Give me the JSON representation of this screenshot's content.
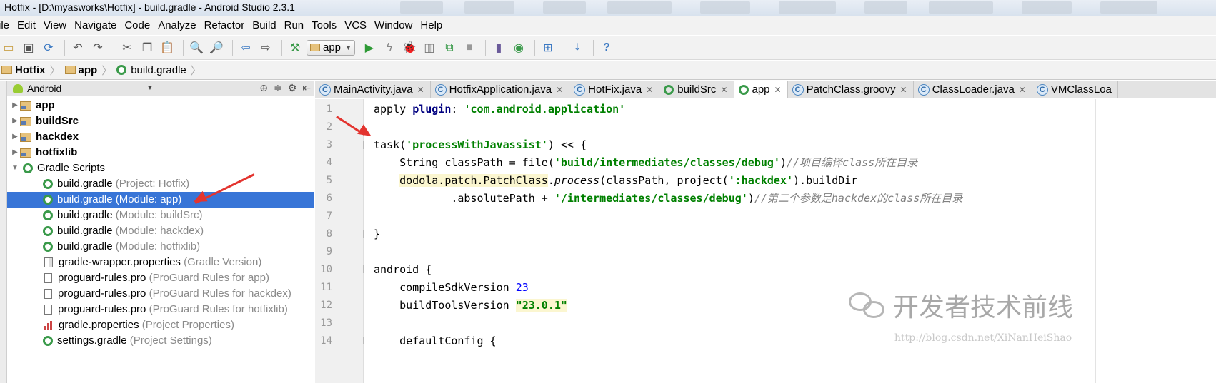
{
  "window": {
    "title": "Hotfix - [D:\\myasworks\\Hotfix] - build.gradle - Android Studio 2.3.1"
  },
  "menu": [
    "ile",
    "Edit",
    "View",
    "Navigate",
    "Code",
    "Analyze",
    "Refactor",
    "Build",
    "Run",
    "Tools",
    "VCS",
    "Window",
    "Help"
  ],
  "toolbar": {
    "run_config": "app"
  },
  "breadcrumb": {
    "project": "Hotfix",
    "module": "app",
    "file": "build.gradle"
  },
  "project_panel": {
    "view_mode": "Android"
  },
  "tree": [
    {
      "label": "app",
      "sub": ""
    },
    {
      "label": "buildSrc",
      "sub": ""
    },
    {
      "label": "hackdex",
      "sub": ""
    },
    {
      "label": "hotfixlib",
      "sub": ""
    },
    {
      "label": "Gradle Scripts",
      "sub": ""
    },
    {
      "label": "build.gradle",
      "sub": "(Project: Hotfix)"
    },
    {
      "label": "build.gradle",
      "sub": "(Module: app)"
    },
    {
      "label": "build.gradle",
      "sub": "(Module: buildSrc)"
    },
    {
      "label": "build.gradle",
      "sub": "(Module: hackdex)"
    },
    {
      "label": "build.gradle",
      "sub": "(Module: hotfixlib)"
    },
    {
      "label": "gradle-wrapper.properties",
      "sub": "(Gradle Version)"
    },
    {
      "label": "proguard-rules.pro",
      "sub": "(ProGuard Rules for app)"
    },
    {
      "label": "proguard-rules.pro",
      "sub": "(ProGuard Rules for hackdex)"
    },
    {
      "label": "proguard-rules.pro",
      "sub": "(ProGuard Rules for hotfixlib)"
    },
    {
      "label": "gradle.properties",
      "sub": "(Project Properties)"
    },
    {
      "label": "settings.gradle",
      "sub": "(Project Settings)"
    }
  ],
  "tabs": [
    "MainActivity.java",
    "HotfixApplication.java",
    "HotFix.java",
    "buildSrc",
    "app",
    "PatchClass.groovy",
    "ClassLoader.java",
    "VMClassLoa"
  ],
  "code": {
    "line_numbers": [
      "1",
      "2",
      "3",
      "4",
      "5",
      "6",
      "7",
      "8",
      "9",
      "10",
      "11",
      "12",
      "13",
      "14"
    ],
    "l1a": "apply ",
    "l1b": "plugin",
    "l1c": ": ",
    "l1d": "'com.android.application'",
    "l3a": "task(",
    "l3b": "'processWithJavassist'",
    "l3c": ") << {",
    "l4a": "    String classPath = file(",
    "l4b": "'build/intermediates/classes/debug'",
    "l4c": ")",
    "l4d": "//项目编译class所在目录",
    "l5a": "    ",
    "l5b": "dodola.patch.PatchClass",
    "l5c": ".",
    "l5d": "process",
    "l5e": "(classPath, project(",
    "l5f": "':hackdex'",
    "l5g": ").buildDir",
    "l6a": "            .absolutePath + ",
    "l6b": "'/intermediates/classes/debug'",
    "l6c": ")",
    "l6d": "//第二个参数是hackdex的class所在目录",
    "l8": "}",
    "l10": "android {",
    "l11a": "    compileSdkVersion ",
    "l11b": "23",
    "l12a": "    buildToolsVersion ",
    "l12b": "\"23.0.1\"",
    "l14": "    defaultConfig {"
  },
  "watermark": {
    "text": "开发者技术前线",
    "url": "http://blog.csdn.net/XiNanHeiShao"
  }
}
